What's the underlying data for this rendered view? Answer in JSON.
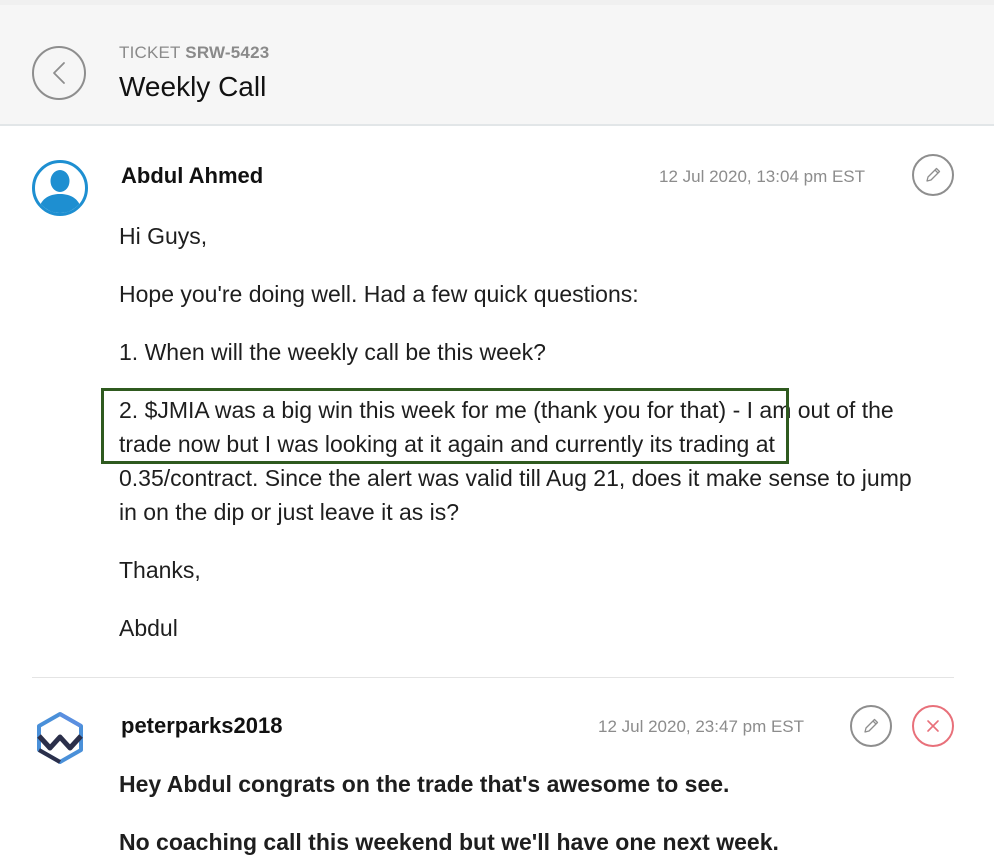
{
  "header": {
    "ticket_prefix": "TICKET",
    "ticket_id": "SRW-5423",
    "title": "Weekly Call",
    "back_icon": "chevron-left-icon"
  },
  "messages": [
    {
      "author": "Abdul Ahmed",
      "timestamp": "12 Jul 2020, 13:04 pm EST",
      "avatar_icon": "user-avatar-icon",
      "avatar_color": "#1e8fd1",
      "actions": [
        "edit"
      ],
      "paragraphs": [
        "Hi Guys,",
        "Hope you're doing well. Had a few quick questions:",
        "1. When will the weekly call be this week?",
        "2. $JMIA was a big win this week for me (thank you for that) - I am out of the trade now but I was looking at it again and currently its trading at 0.35/contract. Since the alert was valid till Aug 21, does it make sense to jump in on the dip or just leave it as is?",
        "Thanks,",
        "Abdul"
      ],
      "highlight_color": "#2f5a1f"
    },
    {
      "author": "peterparks2018",
      "timestamp": "12 Jul 2020, 23:47 pm EST",
      "avatar_icon": "company-logo-icon",
      "actions": [
        "edit",
        "delete"
      ],
      "paragraphs": [
        "Hey Abdul congrats on the trade that's awesome to see.",
        "No coaching call this weekend but we'll have one next week."
      ]
    }
  ],
  "colors": {
    "header_bg": "#f6f6f6",
    "delete_accent": "#e8707a",
    "icon_gray": "#8e8e8e"
  }
}
